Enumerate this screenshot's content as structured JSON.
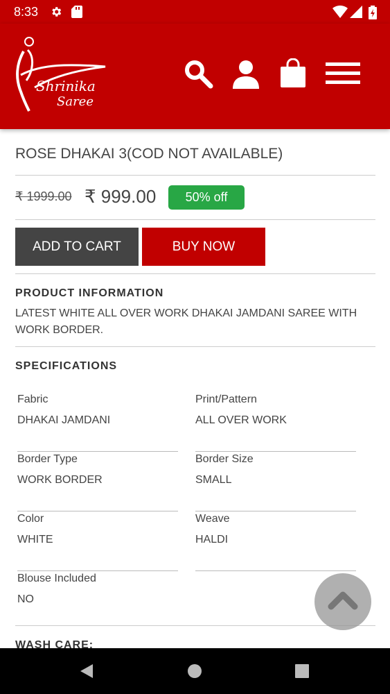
{
  "status_bar": {
    "time": "8:33"
  },
  "header": {
    "brand_line1": "Shrinika",
    "brand_line2": "Saree"
  },
  "product": {
    "title": "ROSE DHAKAI 3(COD NOT AVAILABLE)",
    "old_price": "₹ 1999.00",
    "price": "₹ 999.00",
    "discount": "50% off"
  },
  "actions": {
    "add_to_cart": "ADD TO CART",
    "buy_now": "BUY NOW"
  },
  "info": {
    "heading": "PRODUCT INFORMATION",
    "text": "LATEST WHITE ALL OVER WORK DHAKAI JAMDANI SAREE WITH WORK BORDER."
  },
  "specs": {
    "heading": "SPECIFICATIONS",
    "items": [
      {
        "label": "Fabric",
        "value": "DHAKAI JAMDANI"
      },
      {
        "label": "Print/Pattern",
        "value": "ALL OVER WORK"
      },
      {
        "label": "Border Type",
        "value": "WORK BORDER"
      },
      {
        "label": "Border Size",
        "value": "SMALL"
      },
      {
        "label": "Color",
        "value": "WHITE"
      },
      {
        "label": "Weave",
        "value": "HALDI"
      },
      {
        "label": "Blouse Included",
        "value": "NO"
      }
    ]
  },
  "wash": {
    "heading": "WASH CARE:"
  },
  "colors": {
    "brand_red": "#c10000",
    "dark_button": "#444444",
    "discount_green": "#28a745"
  },
  "icons": [
    "settings-icon",
    "sd-card-icon",
    "wifi-icon",
    "signal-icon",
    "battery-icon",
    "search-icon",
    "user-icon",
    "shopping-bag-icon",
    "menu-icon",
    "scroll-top-icon",
    "back-icon",
    "home-icon",
    "recents-icon"
  ]
}
